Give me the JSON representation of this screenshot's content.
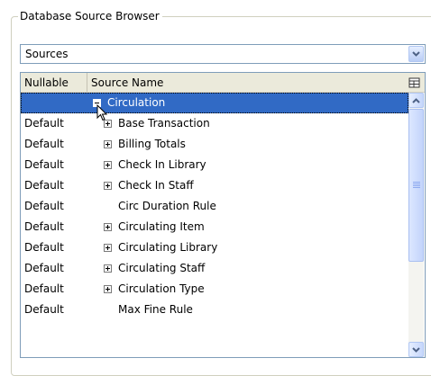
{
  "group": {
    "title": "Database Source Browser"
  },
  "combo": {
    "value": "Sources"
  },
  "grid": {
    "columns": [
      "Nullable",
      "Source Name"
    ],
    "rows": [
      {
        "nullable": "",
        "name": "Circulation",
        "expander": "minus",
        "selected": true
      },
      {
        "nullable": "Default",
        "name": "Base Transaction",
        "expander": "plus"
      },
      {
        "nullable": "Default",
        "name": "Billing Totals",
        "expander": "plus"
      },
      {
        "nullable": "Default",
        "name": "Check In Library",
        "expander": "plus"
      },
      {
        "nullable": "Default",
        "name": "Check In Staff",
        "expander": "plus"
      },
      {
        "nullable": "Default",
        "name": "Circ Duration Rule",
        "expander": "none"
      },
      {
        "nullable": "Default",
        "name": "Circulating Item",
        "expander": "plus"
      },
      {
        "nullable": "Default",
        "name": "Circulating Library",
        "expander": "plus"
      },
      {
        "nullable": "Default",
        "name": "Circulating Staff",
        "expander": "plus"
      },
      {
        "nullable": "Default",
        "name": "Circulation Type",
        "expander": "plus"
      },
      {
        "nullable": "Default",
        "name": "Max Fine Rule",
        "expander": "none"
      }
    ]
  },
  "icons": {
    "combo_dropdown": "chevron-down-icon",
    "column_chooser": "column-chooser-icon",
    "scroll_up": "scroll-up-arrow-icon",
    "scroll_down": "scroll-down-arrow-icon",
    "pointer": "mouse-pointer-icon"
  },
  "colors": {
    "selection": "#316ac5",
    "header_bg": "#ebeadb",
    "border": "#7f9db9",
    "scroll_button": "#c6d7fb"
  },
  "scrollbar": {
    "position_fraction": 0.0,
    "visible_fraction": 0.6
  }
}
